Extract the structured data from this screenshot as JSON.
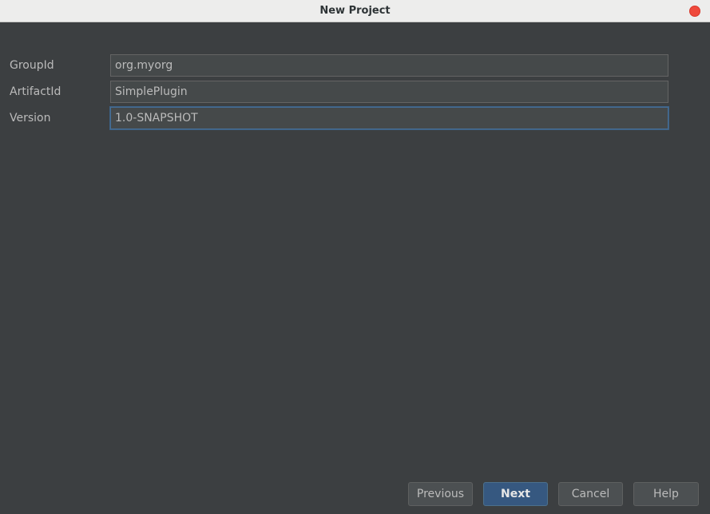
{
  "window": {
    "title": "New Project"
  },
  "form": {
    "fields": [
      {
        "label": "GroupId",
        "value": "org.myorg"
      },
      {
        "label": "ArtifactId",
        "value": "SimplePlugin"
      },
      {
        "label": "Version",
        "value": "1.0-SNAPSHOT"
      }
    ]
  },
  "buttons": {
    "previous": "Previous",
    "next": "Next",
    "cancel": "Cancel",
    "help": "Help"
  },
  "colors": {
    "background": "#3c3f41",
    "close_button": "#ef4a3c",
    "default_button": "#365880",
    "focus_border": "#466d94"
  }
}
